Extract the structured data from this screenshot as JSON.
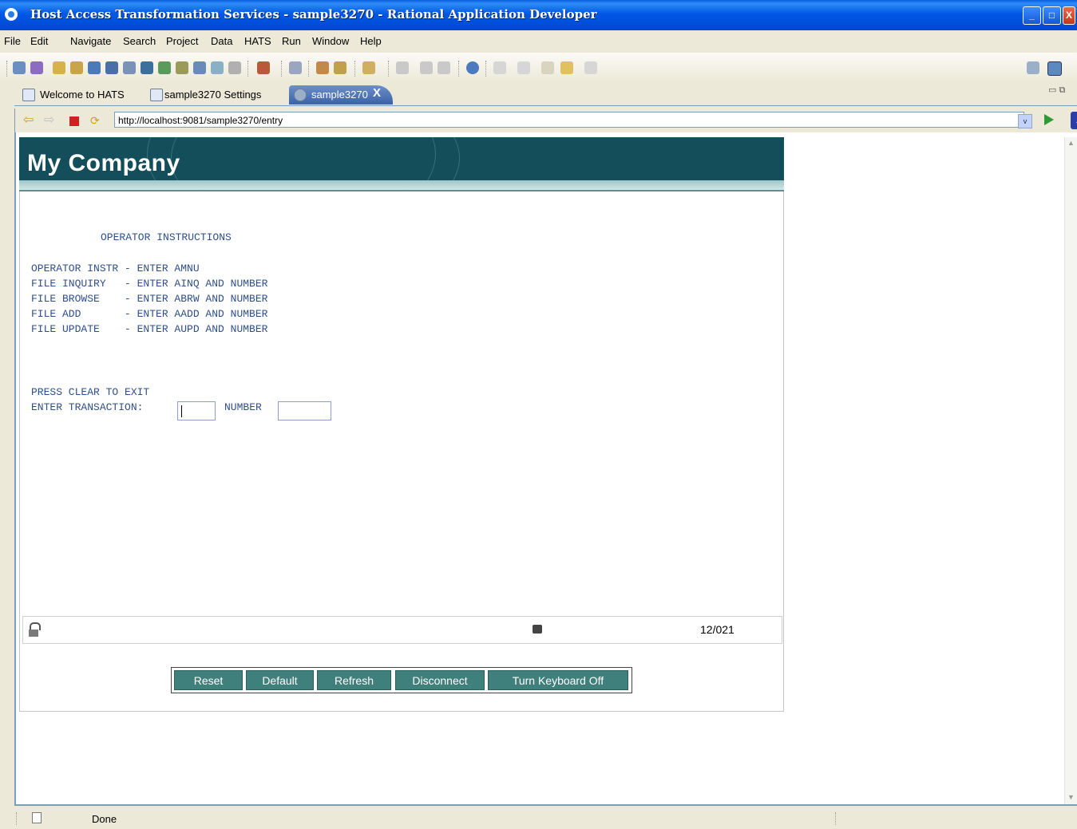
{
  "window": {
    "title": "Host Access Transformation Services - sample3270 - Rational Application Developer",
    "min_glyph": "_",
    "max_glyph": "□",
    "close_glyph": "X"
  },
  "menu": [
    "File",
    "Edit",
    "Navigate",
    "Search",
    "Project",
    "Data",
    "HATS",
    "Run",
    "Window",
    "Help"
  ],
  "tabs": [
    {
      "label": "Welcome to HATS",
      "active": false
    },
    {
      "label": "sample3270 Settings",
      "active": false
    },
    {
      "label": "sample3270",
      "active": true,
      "close": "X"
    }
  ],
  "browser": {
    "url": "http://localhost:9081/sample3270/entry",
    "dropdown_glyph": "v",
    "ext_glyph": "→"
  },
  "hats": {
    "company": "My Company",
    "heading": "OPERATOR INSTRUCTIONS",
    "instructions": [
      "OPERATOR INSTR - ENTER AMNU",
      "FILE INQUIRY   - ENTER AINQ AND NUMBER",
      "FILE BROWSE    - ENTER ABRW AND NUMBER",
      "FILE ADD       - ENTER AADD AND NUMBER",
      "FILE UPDATE    - ENTER AUPD AND NUMBER"
    ],
    "press_clear": "PRESS CLEAR TO EXIT",
    "enter_transaction_label": "ENTER TRANSACTION:",
    "number_label": "NUMBER",
    "transaction_value": "",
    "number_value": "",
    "cursor_position": "12/021",
    "buttons": [
      "Reset",
      "Default",
      "Refresh",
      "Disconnect",
      "Turn Keyboard Off"
    ]
  },
  "status": {
    "text": "Done"
  }
}
